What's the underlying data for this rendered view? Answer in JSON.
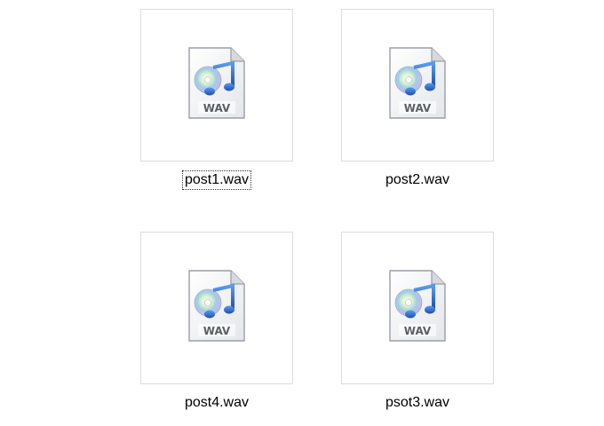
{
  "files": [
    {
      "name": "post1.wav",
      "type_label": "WAV",
      "focused": true
    },
    {
      "name": "post2.wav",
      "type_label": "WAV",
      "focused": false
    },
    {
      "name": "post4.wav",
      "type_label": "WAV",
      "focused": false
    },
    {
      "name": "psot3.wav",
      "type_label": "WAV",
      "focused": false
    }
  ],
  "icon": {
    "name": "wav-audio-file-icon",
    "note_color": "#2a64c8",
    "disc_color": "#9ccfe8"
  }
}
